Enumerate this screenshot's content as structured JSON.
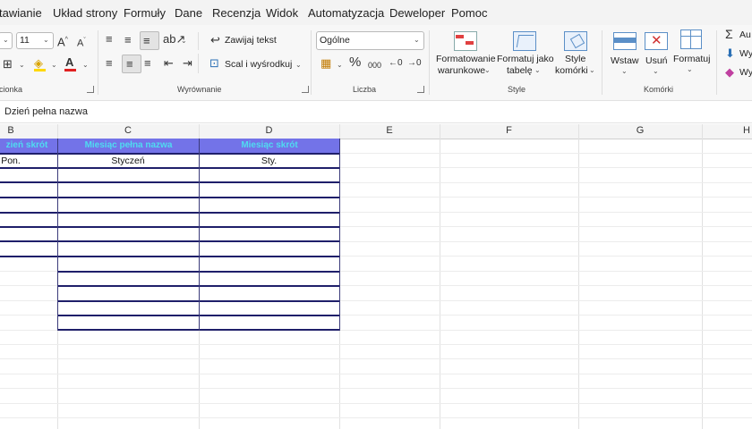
{
  "menu": [
    "tawianie",
    "Układ strony",
    "Formuły",
    "Dane",
    "Recenzja",
    "Widok",
    "Automatyzacja",
    "Deweloper",
    "Pomoc"
  ],
  "ribbon": {
    "font_size": "11",
    "font_grow": "A",
    "font_shrink": "A",
    "wrap_text": "Zawijaj tekst",
    "merge_center": "Scal i wyśrodkuj",
    "number_format": "Ogólne",
    "percent": "%",
    "thousands": "000",
    "conditional_formatting": [
      "Formatowanie",
      "warunkowe"
    ],
    "format_as_table": [
      "Formatuj jako",
      "tabelę"
    ],
    "cell_styles": [
      "Style",
      "komórki"
    ],
    "insert": "Wstaw",
    "delete": "Usuń",
    "format": "Formatuj",
    "autosum": "Au",
    "fill": "Wy",
    "clear": "Wy",
    "groups": {
      "font": "cionka",
      "alignment": "Wyrównanie",
      "number": "Liczba",
      "styles": "Style",
      "cells": "Komórki"
    }
  },
  "formula_bar": {
    "content": "Dzień pełna nazwa"
  },
  "columns": [
    "B",
    "C",
    "D",
    "E",
    "F",
    "G",
    "H"
  ],
  "table": {
    "headers": [
      "zień skrót",
      "Miesiąc pełna nazwa",
      "Miesiąc skrót"
    ],
    "first_row": [
      "Pon.",
      "Styczeń",
      "Sty."
    ]
  },
  "colors": {
    "header_fill": "#7373e8",
    "header_text": "#4fdcf0",
    "table_border": "#1f1f6a"
  }
}
